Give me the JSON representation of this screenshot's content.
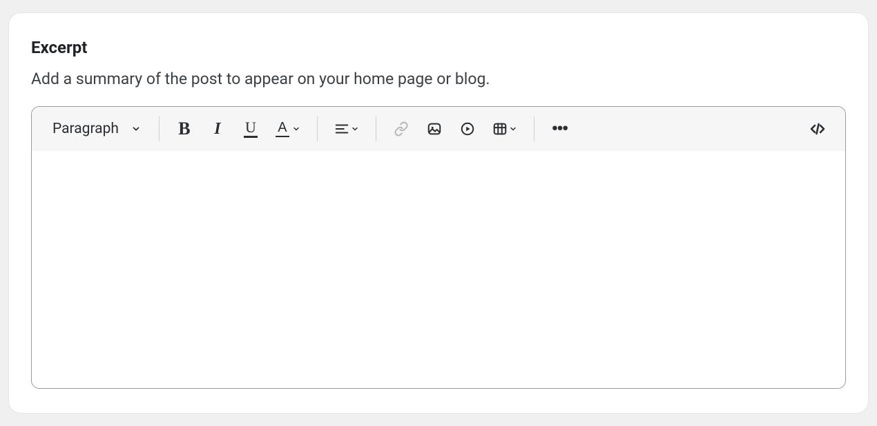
{
  "section": {
    "title": "Excerpt",
    "description": "Add a summary of the post to appear on your home page or blog."
  },
  "toolbar": {
    "block_format": "Paragraph"
  }
}
